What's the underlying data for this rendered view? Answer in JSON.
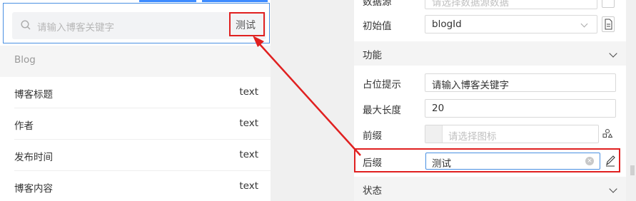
{
  "preview": {
    "search": {
      "placeholder": "请输入博客关键字",
      "suffix": "测试"
    },
    "group_title": "Blog",
    "fields": [
      {
        "label": "博客标题",
        "type": "text"
      },
      {
        "label": "作者",
        "type": "text"
      },
      {
        "label": "发布时间",
        "type": "text"
      },
      {
        "label": "博客内容",
        "type": "text"
      }
    ]
  },
  "panel": {
    "datasource": {
      "label": "数据源",
      "placeholder": "请选择数据源数据"
    },
    "initial_value": {
      "label": "初始值",
      "value": "blogId"
    },
    "section_function": "功能",
    "placeholder_hint": {
      "label": "占位提示",
      "value": "请输入博客关键字"
    },
    "max_length": {
      "label": "最大长度",
      "value": "20"
    },
    "prefix": {
      "label": "前缀",
      "placeholder": "请选择图标"
    },
    "suffix": {
      "label": "后缀",
      "value": "测试"
    },
    "section_status": "状态"
  },
  "colors": {
    "highlight_red": "#e02020",
    "accent_blue": "#4a90e2"
  }
}
